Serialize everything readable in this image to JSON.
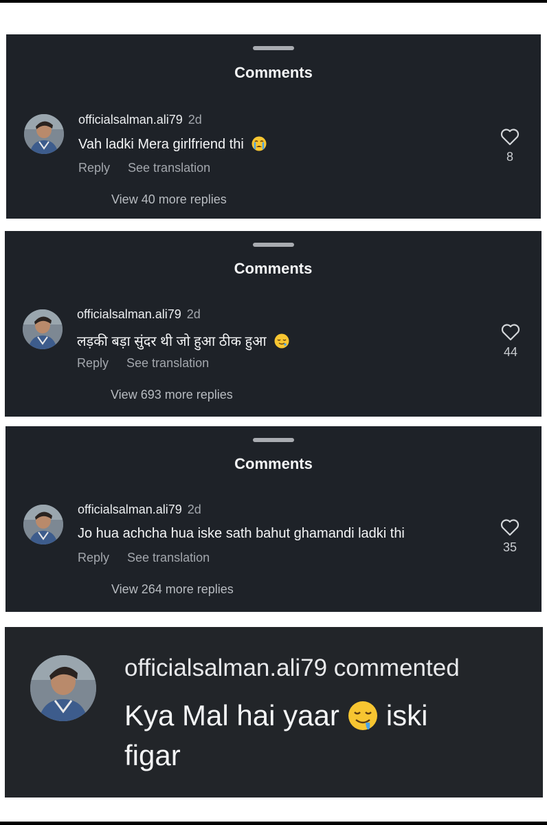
{
  "panels": [
    {
      "title": "Comments",
      "username": "officialsalman.ali79",
      "time": "2d",
      "text": "Vah ladki Mera girlfriend thi",
      "emoji": "crying-emoji",
      "reply": "Reply",
      "translate": "See translation",
      "likes": "8",
      "view_replies": "View 40 more replies"
    },
    {
      "title": "Comments",
      "username": "officialsalman.ali79",
      "time": "2d",
      "text": "लड़की बड़ा सुंदर थी जो हुआ ठीक हुआ",
      "emoji": "relieved-emoji",
      "reply": "Reply",
      "translate": "See translation",
      "likes": "44",
      "view_replies": "View 693 more replies"
    },
    {
      "title": "Comments",
      "username": "officialsalman.ali79",
      "time": "2d",
      "text": "Jo hua achcha hua iske sath bahut ghamandi ladki thi",
      "reply": "Reply",
      "translate": "See translation",
      "likes": "35",
      "view_replies": "View 264 more replies"
    }
  ],
  "notification": {
    "username_line": "officialsalman.ali79 commented",
    "text_line1": "Kya Mal hai yaar",
    "emoji": "drooling-emoji",
    "text_line1_tail": "iski",
    "text_line2": "figar"
  },
  "colors": {
    "panel_bg": "#1e2228",
    "muted_text": "#a3a7ad"
  }
}
